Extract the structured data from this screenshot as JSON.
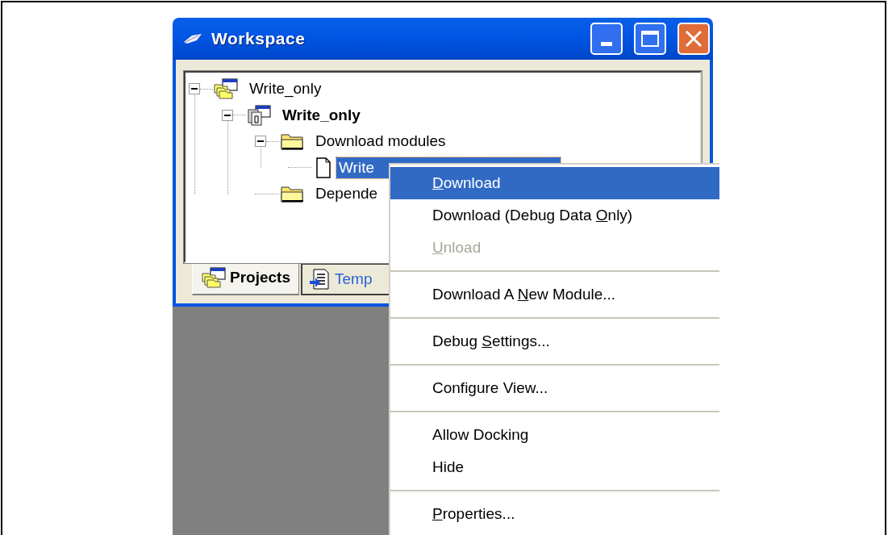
{
  "window": {
    "title": "Workspace"
  },
  "tree": [
    {
      "label": "Write_only",
      "kind": "workspace",
      "bold": false,
      "selected": false,
      "expanded": true,
      "children": [
        {
          "label": "Write_only",
          "kind": "project",
          "bold": true,
          "selected": false,
          "expanded": true,
          "children": [
            {
              "label": "Download modules",
              "kind": "folder",
              "bold": false,
              "selected": false,
              "expanded": true,
              "children": [
                {
                  "label": "Write",
                  "kind": "file",
                  "bold": false,
                  "selected": true
                }
              ]
            },
            {
              "label": "Depende",
              "kind": "folder",
              "bold": false,
              "selected": false
            }
          ]
        }
      ]
    }
  ],
  "tabs": [
    {
      "label": "Projects",
      "kind": "projects",
      "selected": true
    },
    {
      "label": "Temp",
      "kind": "templates",
      "selected": false
    }
  ],
  "context_menu": [
    {
      "kind": "item",
      "key": "D",
      "post": "ownload",
      "selected": true,
      "disabled": false
    },
    {
      "kind": "item",
      "pre": "Download (Debug Data ",
      "key": "O",
      "post": "nly)",
      "selected": false,
      "disabled": false
    },
    {
      "kind": "item",
      "key": "U",
      "post": "nload",
      "selected": false,
      "disabled": true
    },
    {
      "kind": "separator"
    },
    {
      "kind": "item",
      "pre": "Download A ",
      "key": "N",
      "post": "ew Module...",
      "selected": false,
      "disabled": false
    },
    {
      "kind": "separator"
    },
    {
      "kind": "item",
      "pre": "Debug ",
      "key": "S",
      "post": "ettings...",
      "selected": false,
      "disabled": false
    },
    {
      "kind": "separator"
    },
    {
      "kind": "item",
      "pre": "Configure View...",
      "selected": false,
      "disabled": false
    },
    {
      "kind": "separator"
    },
    {
      "kind": "item",
      "pre": "Allow Docking",
      "selected": false,
      "disabled": false
    },
    {
      "kind": "item",
      "pre": "Hide",
      "selected": false,
      "disabled": false
    },
    {
      "kind": "separator"
    },
    {
      "kind": "item",
      "key": "P",
      "post": "roperties...",
      "selected": false,
      "disabled": false
    }
  ]
}
